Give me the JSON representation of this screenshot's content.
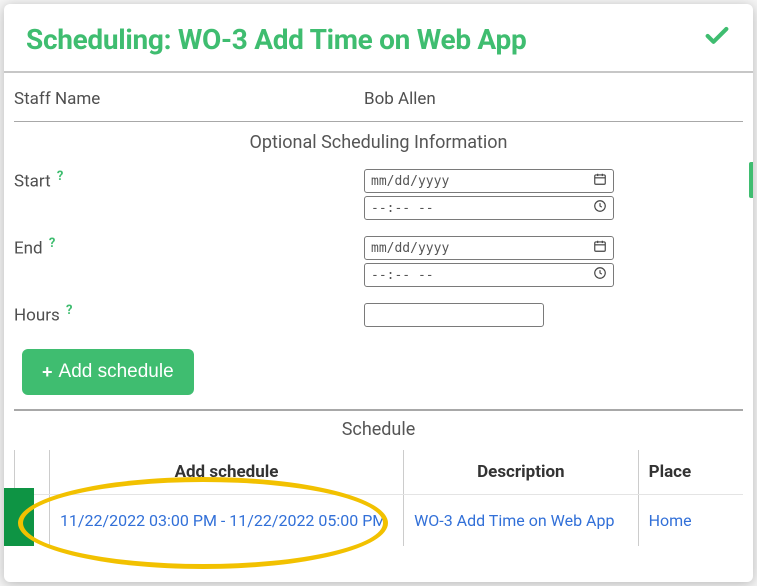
{
  "header": {
    "title": "Scheduling: WO-3 Add Time on Web App"
  },
  "staff": {
    "label": "Staff Name",
    "value": "Bob Allen"
  },
  "section": {
    "optional_title": "Optional Scheduling Information",
    "schedule_title": "Schedule"
  },
  "form": {
    "start_label": "Start",
    "end_label": "End",
    "hours_label": "Hours",
    "date_placeholder": "mm/dd/yyyy",
    "time_placeholder": "--:--  --",
    "add_button": "Add schedule"
  },
  "table": {
    "headers": {
      "schedule": "Add schedule",
      "description": "Description",
      "place": "Place"
    },
    "rows": [
      {
        "schedule": "11/22/2022 03:00 PM - 11/22/2022 05:00 PM",
        "description": "WO-3 Add Time on Web App",
        "place": "Home"
      }
    ]
  }
}
